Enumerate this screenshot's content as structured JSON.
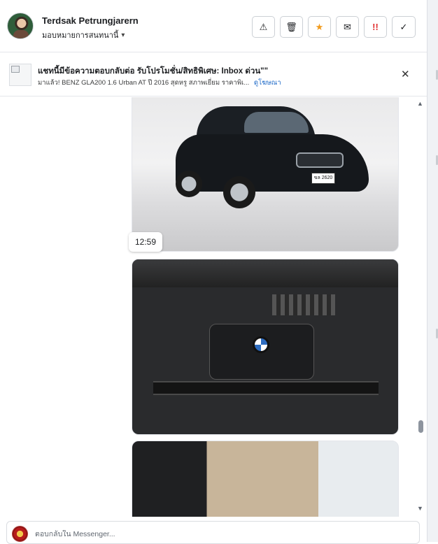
{
  "header": {
    "contact_name": "Terdsak Petrungjarern",
    "assign_label": "มอบหมายการสนทนานี้",
    "assign_caret": "▾",
    "actions": [
      {
        "name": "report-button",
        "glyph": "⚠"
      },
      {
        "name": "delete-button",
        "glyph": "🗑"
      },
      {
        "name": "star-button",
        "glyph": "★"
      },
      {
        "name": "mark-unread-button",
        "glyph": "✉"
      },
      {
        "name": "urgent-button",
        "glyph": "!!"
      },
      {
        "name": "done-button",
        "glyph": "✓"
      }
    ]
  },
  "banner": {
    "title": "แชทนี้มีข้อความตอบกลับต่อ รับโปรโมชั่น/สิทธิพิเศษ: Inbox ด่วน\"\"",
    "subtitle": "มาแล้ว! BENZ GLA200 1.6 Urban AT ปี 2016 สุดหรู สภาพเยี่ยม ราคาพิเ...",
    "link": "ดูโฆษณา",
    "close_glyph": "✕"
  },
  "chat": {
    "timestamp": "12:59",
    "car_plate": "ขล 2620",
    "images": [
      {
        "name": "car-exterior-photo",
        "description": "black BMW X1 front three-quarter view"
      },
      {
        "name": "engine-bay-photo",
        "description": "engine bay with BMW logo cover"
      },
      {
        "name": "door-interior-photo",
        "description": "open driver door interior panel"
      }
    ]
  },
  "scrollbar": {
    "up_glyph": "▲",
    "down_glyph": "▼"
  },
  "composer": {
    "placeholder": "ตอบกลับใน Messenger..."
  }
}
